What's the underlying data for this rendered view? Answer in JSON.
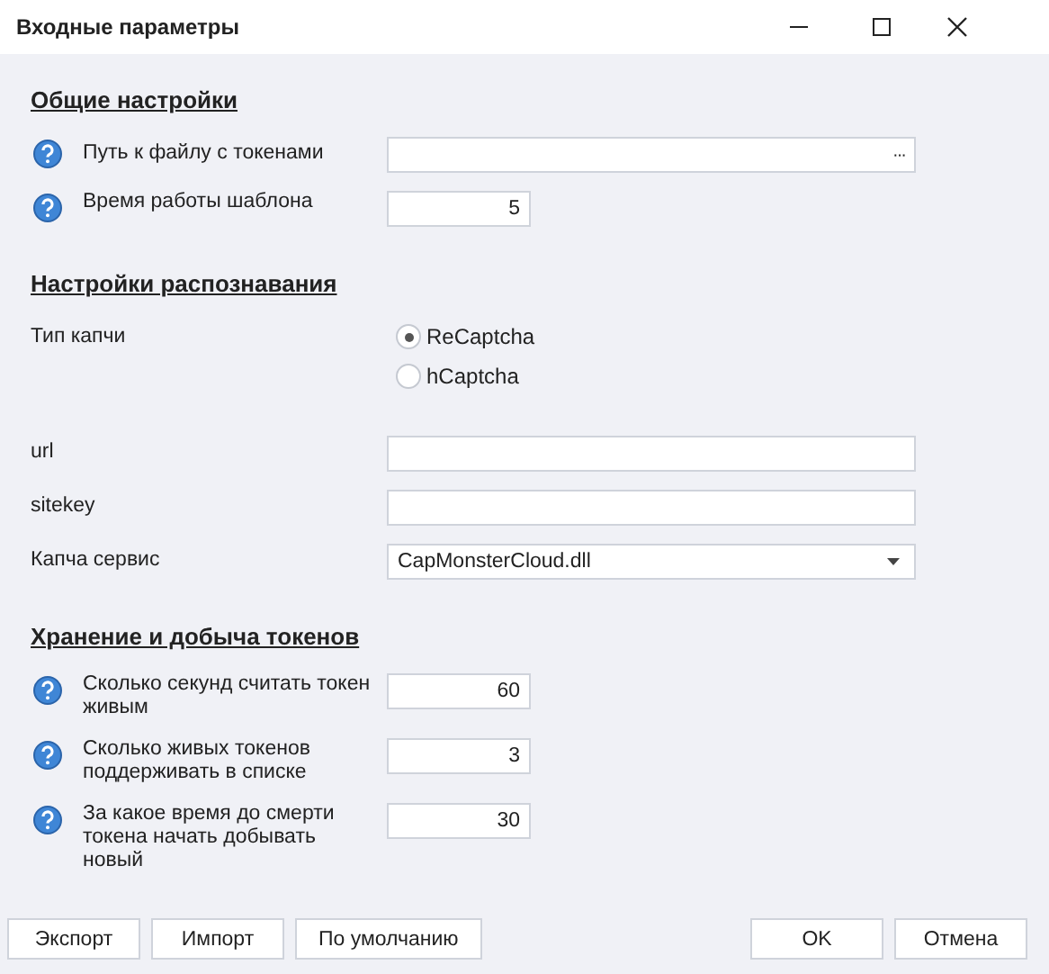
{
  "window": {
    "title": "Входные параметры"
  },
  "sections": [
    {
      "title": "Общие настройки",
      "rows": [
        {
          "kind": "path",
          "help": true,
          "label": "Путь к файлу с токенами",
          "browse": "···"
        },
        {
          "kind": "number",
          "help": true,
          "label": "Время работы шаблона",
          "value": "5"
        }
      ]
    },
    {
      "title": "Настройки распознавания",
      "rows": [
        {
          "kind": "radio",
          "help": false,
          "label": "Тип капчи",
          "options": [
            {
              "label": "ReCaptcha",
              "selected": true
            },
            {
              "label": "hCaptcha",
              "selected": false
            }
          ]
        },
        {
          "kind": "text",
          "help": false,
          "label": "url"
        },
        {
          "kind": "text",
          "help": false,
          "label": "sitekey"
        },
        {
          "kind": "dropdown",
          "help": false,
          "label": "Капча сервис",
          "value": "CapMonsterCloud.dll"
        }
      ]
    },
    {
      "title": "Хранение и добыча токенов",
      "rows": [
        {
          "kind": "number",
          "help": true,
          "label": "Сколько секунд считать токен живым",
          "value": "60"
        },
        {
          "kind": "number",
          "help": true,
          "label": "Сколько живых токенов поддерживать в списке",
          "value": "3"
        },
        {
          "kind": "number",
          "help": true,
          "label": "За какое время до смерти токена начать добывать новый",
          "value": "30"
        }
      ]
    }
  ],
  "buttons": {
    "left": [
      "Экспорт",
      "Импорт",
      "По умолчанию"
    ],
    "right": [
      "OK",
      "Отмена"
    ]
  }
}
